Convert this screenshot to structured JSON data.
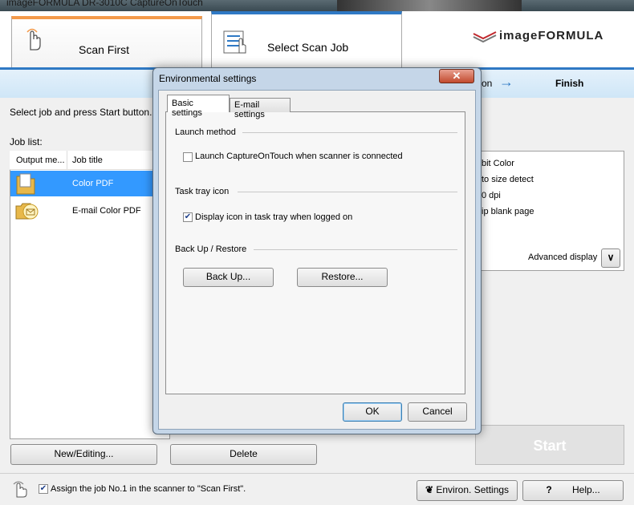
{
  "window": {
    "title": "imageFORMULA DR-3010C CaptureOnTouch"
  },
  "header": {
    "tab_scan_first": "Scan First",
    "tab_select_scan_job": "Select Scan Job",
    "brand": "imageFORMULA"
  },
  "steps": {
    "finish": "Finish",
    "step_on": "on"
  },
  "main": {
    "instruction": "Select job and press Start button.",
    "job_list_label": "Job list:",
    "columns": [
      "Output me...",
      "Job title"
    ],
    "jobs": [
      {
        "title": "Color PDF",
        "icon": "folder-icon"
      },
      {
        "title": "E-mail Color PDF",
        "icon": "email-icon"
      }
    ],
    "details": [
      "bit Color",
      "to size detect",
      "0 dpi",
      "ip blank page"
    ],
    "advanced_display": "Advanced display",
    "new_editing": "New/Editing...",
    "delete": "Delete",
    "start": "Start"
  },
  "footer": {
    "assign_text": "Assign the job No.1 in the scanner to \"Scan First\".",
    "environ_settings": "Environ. Settings",
    "help": "Help..."
  },
  "dialog": {
    "title": "Environmental settings",
    "tabs": [
      "Basic settings",
      "E-mail settings"
    ],
    "launch_method": "Launch method",
    "launch_checkbox": "Launch CaptureOnTouch when scanner is connected",
    "task_tray": "Task tray icon",
    "tray_checkbox": "Display icon in task tray when logged on",
    "backup_restore": "Back Up / Restore",
    "backup": "Back Up...",
    "restore": "Restore...",
    "ok": "OK",
    "cancel": "Cancel"
  },
  "colors": {
    "accent_blue": "#2f79c4",
    "accent_orange": "#f39a4b",
    "selection": "#3399ff"
  }
}
